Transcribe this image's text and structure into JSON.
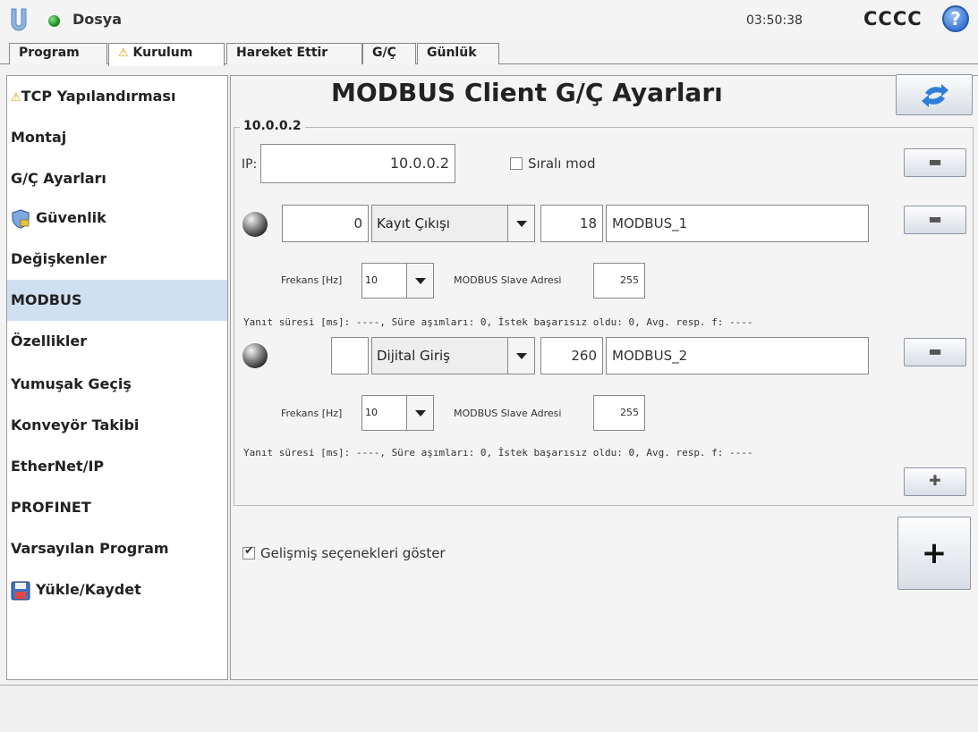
{
  "header": {
    "app_menu": "Dosya",
    "time": "03:50:38",
    "user": "CCCC",
    "help_symbol": "?"
  },
  "tabs": {
    "program": "Program",
    "kurulum": "Kurulum",
    "hareket": "Hareket Ettir",
    "gc": "G/Ç",
    "gunluk": "Günlük"
  },
  "sidebar": {
    "items": [
      {
        "label": "TCP Yapılandırması",
        "icon": "warning-icon"
      },
      {
        "label": "Montaj"
      },
      {
        "label": "G/Ç Ayarları"
      },
      {
        "label": "Güvenlik",
        "icon": "shield-icon"
      },
      {
        "label": "Değişkenler"
      },
      {
        "label": "MODBUS",
        "active": true
      },
      {
        "label": "Özellikler"
      },
      {
        "label": "Yumuşak Geçiş"
      },
      {
        "label": "Konveyör Takibi"
      },
      {
        "label": "EtherNet/IP"
      },
      {
        "label": "PROFINET"
      },
      {
        "label": "Varsayılan Program"
      },
      {
        "label": "Yükle/Kaydet",
        "icon": "save-icon"
      }
    ]
  },
  "main": {
    "title": "MODBUS Client G/Ç Ayarları",
    "group_title": "10.0.0.2",
    "ip_label": "IP:",
    "ip_value": "10.0.0.2",
    "sequential_label": "Sıralı mod",
    "minus_symbol": "▬",
    "plus_small_symbol": "✚",
    "plus_symbol": "+",
    "signals": [
      {
        "address": "0",
        "type": "Kayıt Çıkışı",
        "register": "18",
        "name": "MODBUS_1",
        "freq_label": "Frekans [Hz]",
        "freq": "10",
        "slave_label": "MODBUS Slave Adresi",
        "slave": "255",
        "status": "Yanıt süresi [ms]: ----, Süre aşımları: 0, İstek başarısız oldu: 0, Avg. resp. f: ----"
      },
      {
        "address": "",
        "type": "Dijital Giriş",
        "register": "260",
        "name": "MODBUS_2",
        "freq_label": "Frekans [Hz]",
        "freq": "10",
        "slave_label": "MODBUS Slave Adresi",
        "slave": "255",
        "status": "Yanıt süresi [ms]: ----, Süre aşımları: 0, İstek başarısız oldu: 0, Avg. resp. f: ----"
      }
    ],
    "advanced_label": "Gelişmiş seçenekleri göster",
    "advanced_checked": true
  },
  "colors": {
    "accent": "#cfe0f1",
    "warning": "#d4a000",
    "help": "#3a78d4"
  }
}
